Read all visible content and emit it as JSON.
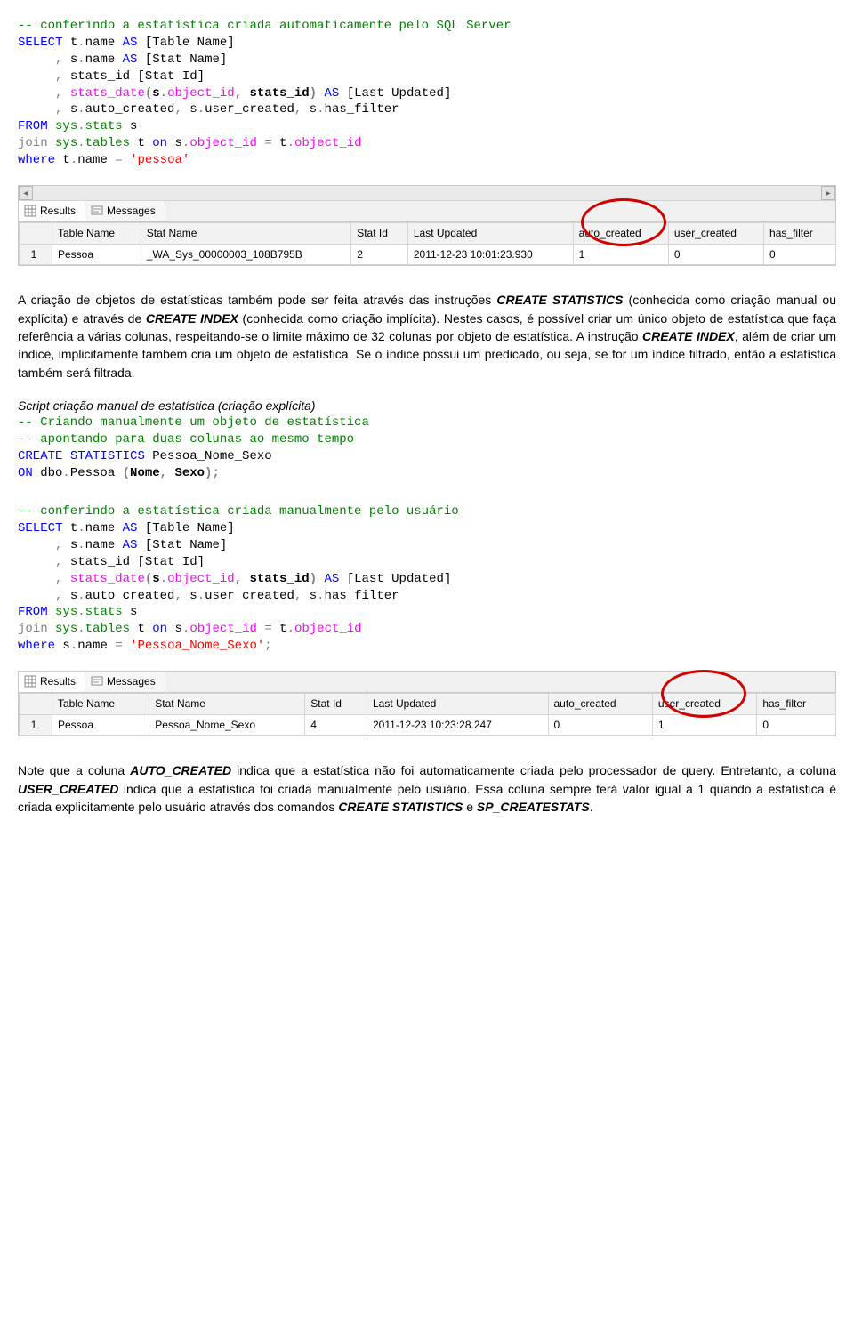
{
  "code1": {
    "c1": "-- conferindo a estatística criada automaticamente pelo SQL Server",
    "l2a": "SELECT",
    "l2b": " t",
    "l2c": ".",
    "l2d": "name ",
    "l2e": "AS",
    "l2f": " [Table Name]",
    "l3a": "     ",
    "l3b": ",",
    "l3c": " s",
    "l3d": ".",
    "l3e": "name ",
    "l3f": "AS",
    "l3g": " [Stat Name]",
    "l4a": "     ",
    "l4b": ",",
    "l4c": " stats_id [Stat Id]",
    "l5a": "     ",
    "l5b": ",",
    "l5c": " ",
    "l5d": "stats_date",
    "l5e": "(",
    "l5f": "s",
    "l5g": ".",
    "l5h": "object_id",
    "l5i": ",",
    "l5j": " stats_id",
    "l5k": ")",
    "l5l": " ",
    "l5m": "AS",
    "l5n": " [Last Updated]",
    "l6a": "     ",
    "l6b": ",",
    "l6c": " s",
    "l6d": ".",
    "l6e": "auto_created",
    "l6f": ",",
    "l6g": " s",
    "l6h": ".",
    "l6i": "user_created",
    "l6j": ",",
    "l6k": " s",
    "l6l": ".",
    "l6m": "has_filter",
    "l7a": "FROM",
    "l7b": " ",
    "l7c": "sys",
    "l7d": ".",
    "l7e": "stats",
    "l7f": " s",
    "l8a": "join",
    "l8b": " ",
    "l8c": "sys",
    "l8d": ".",
    "l8e": "tables",
    "l8f": " t ",
    "l8g": "on",
    "l8h": " s",
    "l8i": ".",
    "l8j": "object_id",
    "l8k": " ",
    "l8l": "=",
    "l8m": " t",
    "l8n": ".",
    "l8o": "object_id",
    "l9a": "where",
    "l9b": " t",
    "l9c": ".",
    "l9d": "name ",
    "l9e": "=",
    "l9f": " ",
    "l9g": "'pessoa'"
  },
  "tabs": {
    "results": "Results",
    "messages": "Messages"
  },
  "table1": {
    "headers": [
      "Table Name",
      "Stat Name",
      "Stat Id",
      "Last Updated",
      "auto_created",
      "user_created",
      "has_filter"
    ],
    "rownum": "1",
    "cells": [
      "Pessoa",
      "_WA_Sys_00000003_108B795B",
      "2",
      "2011-12-23 10:01:23.930",
      "1",
      "0",
      "0"
    ]
  },
  "para1": {
    "t1": "A criação de objetos de estatísticas também pode ser feita através das instruções ",
    "t2": "CREATE STATISTICS",
    "t3": " (conhecida como criação manual ou explícita) e através de ",
    "t4": "CREATE INDEX",
    "t5": " (conhecida como criação implícita). Nestes casos, é possível criar um único objeto de estatística que faça referência a várias colunas, respeitando-se o limite máximo de 32 colunas por objeto de estatística. A instrução ",
    "t6": "CREATE INDEX",
    "t7": ", além de criar um índice, implicitamente também cria um objeto de estatística. Se o índice possui um predicado, ou seja, se for um índice filtrado, então a estatística também será filtrada."
  },
  "scriptTitle": "Script criação manual de estatística (criação explícita)",
  "code2": {
    "c1": "-- Criando manualmente um objeto de estatística",
    "c2": "-- apontando para duas colunas ao mesmo tempo",
    "l3a": "CREATE",
    "l3b": " ",
    "l3c": "STATISTICS",
    "l3d": " Pessoa_Nome_Sexo",
    "l4a": "ON",
    "l4b": " dbo",
    "l4c": ".",
    "l4d": "Pessoa ",
    "l4e": "(",
    "l4f": "Nome",
    "l4g": ",",
    "l4h": " Sexo",
    "l4i": ");"
  },
  "code3": {
    "c1": "-- conferindo a estatística criada manualmente pelo usuário",
    "l9a": "where",
    "l9b": " s",
    "l9c": ".",
    "l9d": "name ",
    "l9e": "=",
    "l9f": " ",
    "l9g": "'Pessoa_Nome_Sexo'",
    "l9h": ";"
  },
  "table2": {
    "headers": [
      "Table Name",
      "Stat Name",
      "Stat Id",
      "Last Updated",
      "auto_created",
      "user_created",
      "has_filter"
    ],
    "rownum": "1",
    "cells": [
      "Pessoa",
      "Pessoa_Nome_Sexo",
      "4",
      "2011-12-23 10:23:28.247",
      "0",
      "1",
      "0"
    ]
  },
  "para2": {
    "t1": "Note que a coluna ",
    "t2": "AUTO_CREATED",
    "t3": " indica que a estatística não foi automaticamente criada pelo processador de query. Entretanto, a coluna ",
    "t4": "USER_CREATED",
    "t5": " indica que a estatística foi criada manualmente pelo usuário. Essa coluna sempre terá valor igual a 1 quando a estatística é criada explicitamente pelo usuário através dos comandos ",
    "t6": "CREATE STATISTICS",
    "t7": " e ",
    "t8": "SP_CREATESTATS",
    "t9": "."
  }
}
